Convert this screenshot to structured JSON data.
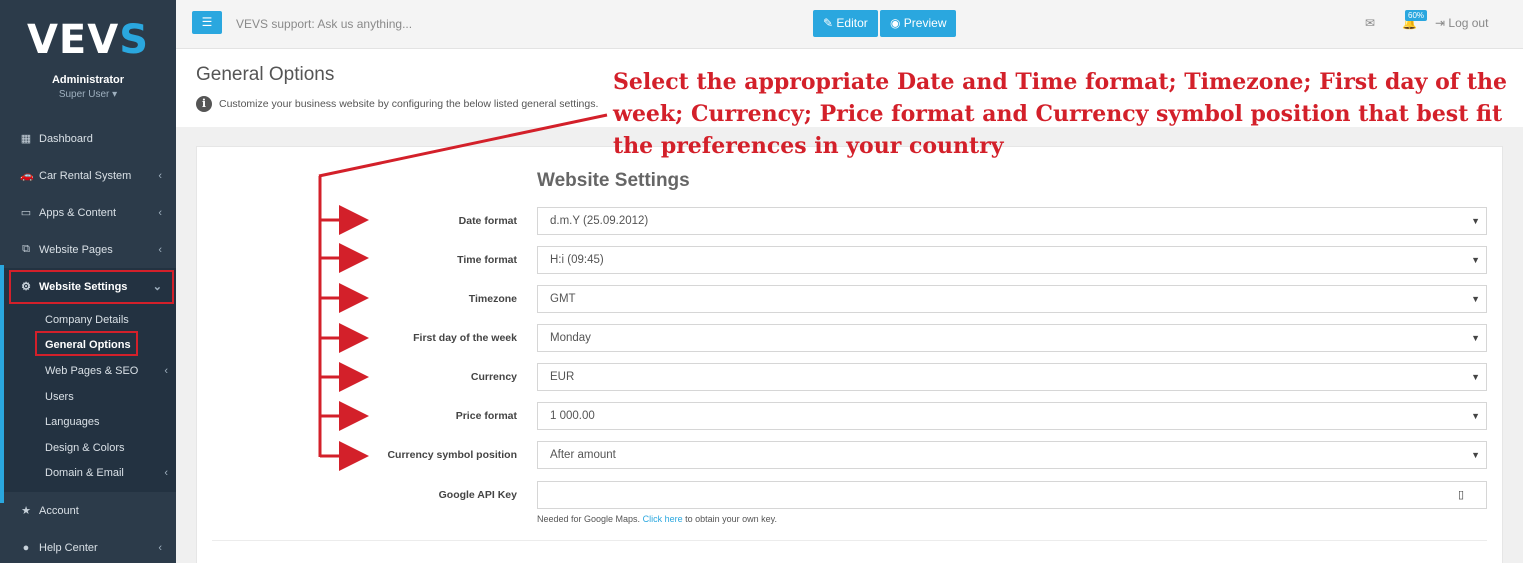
{
  "brand": {
    "logo_main": "VEV",
    "logo_accent": "S"
  },
  "user": {
    "name": "Administrator",
    "role": "Super User ▾"
  },
  "sidebar": {
    "items": [
      {
        "label": "Dashboard",
        "icon": "dashboard-icon"
      },
      {
        "label": "Car Rental System",
        "icon": "car-icon"
      },
      {
        "label": "Apps & Content",
        "icon": "monitor-icon"
      },
      {
        "label": "Website Pages",
        "icon": "pages-icon"
      },
      {
        "label": "Website Settings",
        "icon": "gears-icon"
      }
    ],
    "subitems": [
      {
        "label": "Company Details"
      },
      {
        "label": "General Options"
      },
      {
        "label": "Web Pages & SEO"
      },
      {
        "label": "Users"
      },
      {
        "label": "Languages"
      },
      {
        "label": "Design & Colors"
      },
      {
        "label": "Domain & Email"
      }
    ],
    "bottom": [
      {
        "label": "Account",
        "icon": "star-icon"
      },
      {
        "label": "Help Center",
        "icon": "help-icon"
      }
    ]
  },
  "topbar": {
    "support_text": "VEVS support: Ask us anything...",
    "editor_label": "✎ Editor",
    "preview_label": "◉ Preview",
    "badge": "60%",
    "logout_label": "Log out"
  },
  "page": {
    "title": "General Options",
    "description": "Customize your business website by configuring the below listed general settings."
  },
  "form": {
    "section_title": "Website Settings",
    "fields": [
      {
        "label": "Date format",
        "value": "d.m.Y (25.09.2012)"
      },
      {
        "label": "Time format",
        "value": "H:i (09:45)"
      },
      {
        "label": "Timezone",
        "value": "GMT"
      },
      {
        "label": "First day of the week",
        "value": "Monday"
      },
      {
        "label": "Currency",
        "value": "EUR"
      },
      {
        "label": "Price format",
        "value": "1 000.00"
      },
      {
        "label": "Currency symbol position",
        "value": "After amount"
      }
    ],
    "api_key_label": "Google API Key",
    "api_key_value": "",
    "help_text": "Needed for Google Maps.",
    "help_link": "Click here",
    "help_suffix": "to obtain your own key."
  },
  "annotation": {
    "text": "Select the appropriate Date and Time format; Timezone; First day of the week; Currency; Price format and Currency symbol position that best fit the preferences in your country",
    "color": "#d3202a"
  },
  "colors": {
    "accent": "#2aa7df",
    "sidebar": "#2c3b4a",
    "highlight": "#d3202a"
  }
}
